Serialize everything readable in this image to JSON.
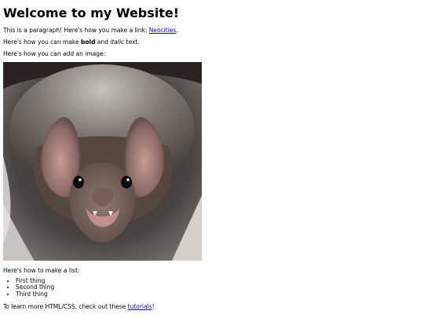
{
  "heading": "Welcome to my Website!",
  "para1": {
    "text": "This is a paragraph! Here's how you make a link: ",
    "link": "Neocities",
    "end": "."
  },
  "para2": {
    "pre": "Here's how you can make ",
    "bold": "bold",
    "mid": " and ",
    "italic": "italic",
    "end": " text."
  },
  "para3": "Here's how you can add an image:",
  "image": {
    "subject": "vampire bat close-up photo"
  },
  "list_intro": "Here's how to make a list:",
  "list": [
    "First thing",
    "Second thing",
    "Third thing"
  ],
  "footer": {
    "pre": "To learn more HTML/CSS, check out these ",
    "link": "tutorials",
    "end": "!"
  },
  "colors": {
    "link": "#0000ee",
    "text": "#000000",
    "background": "#ffffff"
  }
}
